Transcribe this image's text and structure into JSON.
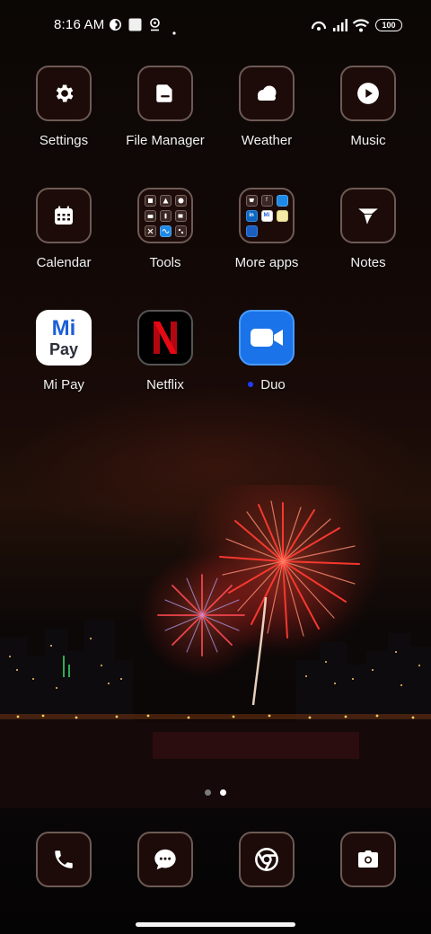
{
  "status_bar": {
    "time": "8:16 AM",
    "battery": "100",
    "icons": [
      "data-saver-icon",
      "square-notification-icon",
      "location-pin-icon",
      "dot-icon",
      "hotspot-icon",
      "signal-icon",
      "wifi-icon",
      "battery-icon"
    ]
  },
  "apps": {
    "settings": "Settings",
    "file_manager": "File Manager",
    "weather": "Weather",
    "music": "Music",
    "calendar": "Calendar",
    "tools": "Tools",
    "more_apps": "More apps",
    "notes": "Notes",
    "mi_pay": "Mi Pay",
    "netflix": "Netflix",
    "duo": "Duo"
  },
  "mi_pay_logo": {
    "line1": "Mi",
    "line2": "Pay"
  },
  "more_apps_mini": {
    "f": "f",
    "in": "in",
    "mi": "Mi"
  },
  "pager": {
    "pages": 2,
    "current": 2
  },
  "dock": [
    "phone-icon",
    "messages-icon",
    "chrome-icon",
    "camera-icon"
  ],
  "colors": {
    "tile_bg": "#1c0b08",
    "tile_border": "#6e5a55",
    "duo_blue": "#1a73e8",
    "netflix_red": "#e50914",
    "mipay_blue": "#1d5fd6"
  }
}
